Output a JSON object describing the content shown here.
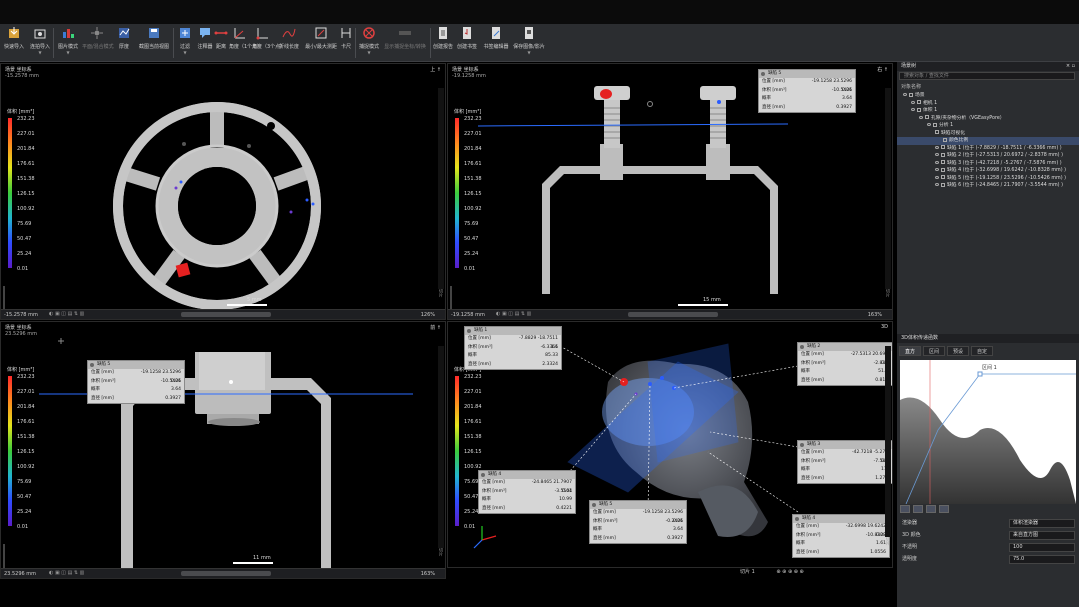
{
  "ribbon": [
    {
      "id": "import",
      "label": "快速导入",
      "icon": "import-icon"
    },
    {
      "id": "capture",
      "label": "连拍导入",
      "icon": "capture-icon",
      "has_menu": true
    },
    {
      "id": "render-mode",
      "label": "图片模式",
      "icon": "render-mode-icon",
      "has_menu": true
    },
    {
      "id": "flat-mode",
      "label": "平面/混合模式",
      "icon": "light-icon",
      "dim": true
    },
    {
      "id": "profile",
      "label": "厚度",
      "icon": "profile-icon"
    },
    {
      "id": "save-view",
      "label": "截图当前视图",
      "icon": "save-view-icon"
    },
    {
      "id": "filter",
      "label": "过滤",
      "icon": "filter-icon",
      "has_menu": true
    },
    {
      "id": "annotation",
      "label": "注释器",
      "icon": "comment-icon"
    },
    {
      "id": "distance",
      "label": "距离",
      "icon": "ruler-icon"
    },
    {
      "id": "angle1",
      "label": "角度（1个点）",
      "icon": "angle-icon"
    },
    {
      "id": "angle3",
      "label": "角度（3个点）",
      "icon": "angle3-icon"
    },
    {
      "id": "curve",
      "label": "折线长度",
      "icon": "curve-icon"
    },
    {
      "id": "minmax",
      "label": "最小/最大测距",
      "icon": "minmax-icon"
    },
    {
      "id": "caliper",
      "label": "卡尺",
      "icon": "caliper-icon"
    },
    {
      "id": "capture-mode",
      "label": "捕捉模式",
      "icon": "capture-mode-icon",
      "has_menu": true
    },
    {
      "id": "nudge",
      "label": "显示捕捉坐标/转换",
      "icon": "nudge-icon",
      "dim": true
    },
    {
      "id": "report",
      "label": "创建报告",
      "icon": "report-icon"
    },
    {
      "id": "bookmark",
      "label": "创建书签",
      "icon": "bookmark-icon"
    },
    {
      "id": "note-editor",
      "label": "书签编辑器",
      "icon": "note-editor-icon"
    },
    {
      "id": "save-image",
      "label": "保存图像/影片",
      "icon": "save-image-icon",
      "has_menu": true
    }
  ],
  "viewports": {
    "top_left": {
      "name": "场景 坐标系",
      "coord": "-15.2578 mm",
      "corner": "上 ↑",
      "side_label": "切片",
      "scroll_value": "-15.2578 mm",
      "zoom": "126%",
      "scale_label": "5 mm",
      "legend_title": "体积 [mm³]"
    },
    "top_right": {
      "name": "场景 坐标系",
      "coord": "-19.1258 mm",
      "corner": "右 ↑",
      "side_label": "切片",
      "scroll_value": "-19.1258 mm",
      "zoom": "163%",
      "scale_label": "15 mm",
      "legend_title": "体积 [mm³]"
    },
    "bottom_left": {
      "name": "场景 坐标系",
      "coord": "23.5296 mm",
      "corner": "前 ↑",
      "side_label": "切片",
      "scroll_value": "23.5296 mm",
      "zoom": "163%",
      "scale_label": "11 mm",
      "legend_title": "体积 [mm³]"
    },
    "bottom_right": {
      "name": "",
      "coord": "",
      "corner": "3D",
      "side_label": "切片",
      "legend_title": "体积 [mm³]"
    }
  },
  "legend_ticks": [
    "232.23",
    "227.01",
    "201.84",
    "176.61",
    "151.38",
    "126.15",
    "100.92",
    "75.69",
    "50.47",
    "25.24",
    "0.01"
  ],
  "annotations": [
    {
      "id": "vr-tr",
      "title": "缺陷 5",
      "rows": [
        [
          "位置 [mm]",
          "-19.1258  23.5296  -10.5426"
        ],
        [
          "体积 [mm³]",
          "0.01"
        ],
        [
          "概率",
          "3.64"
        ],
        [
          "直径 [mm]",
          "0.3927"
        ]
      ]
    },
    {
      "id": "vr-bl",
      "title": "缺陷 5",
      "rows": [
        [
          "位置 [mm]",
          "-19.1258  23.5296  -10.5426"
        ],
        [
          "体积 [mm³]",
          "0.01"
        ],
        [
          "概率",
          "3.64"
        ],
        [
          "直径 [mm]",
          "0.3927"
        ]
      ]
    },
    {
      "id": "3d-1",
      "title": "缺陷 1",
      "rows": [
        [
          "位置 [mm]",
          "-7.8829  -18.7511  -6.3366"
        ],
        [
          "体积 [mm³]",
          "1.1"
        ],
        [
          "概率",
          "85.33"
        ],
        [
          "直径 [mm]",
          "2.3324"
        ]
      ]
    },
    {
      "id": "3d-2",
      "title": "缺陷 2",
      "rows": [
        [
          "位置 [mm]",
          "-27.5313  20.6972  -2.8378"
        ],
        [
          "体积 [mm³]",
          "0.11"
        ],
        [
          "概率",
          "51.16"
        ],
        [
          "直径 [mm]",
          "0.8185"
        ]
      ]
    },
    {
      "id": "3d-3",
      "title": "缺陷 3",
      "rows": [
        [
          "位置 [mm]",
          "-42.7218  -5.2767  -7.5876"
        ],
        [
          "体积 [mm³]",
          "0.15"
        ],
        [
          "概率",
          "11.4"
        ],
        [
          "直径 [mm]",
          "1.2763"
        ]
      ]
    },
    {
      "id": "3d-4a",
      "title": "缺陷 4",
      "rows": [
        [
          "位置 [mm]",
          "-24.8465  21.7907  -3.5544"
        ],
        [
          "体积 [mm³]",
          "0.01"
        ],
        [
          "概率",
          "10.99"
        ],
        [
          "直径 [mm]",
          "0.4221"
        ]
      ]
    },
    {
      "id": "3d-5",
      "title": "缺陷 5",
      "rows": [
        [
          "位置 [mm]",
          "-19.1258  23.5296  -0.2426"
        ],
        [
          "体积 [mm³]",
          "0.01"
        ],
        [
          "概率",
          "3.64"
        ],
        [
          "直径 [mm]",
          "0.3927"
        ]
      ]
    },
    {
      "id": "3d-4b",
      "title": "缺陷 4",
      "rows": [
        [
          "位置 [mm]",
          "-32.6998  19.6242  -10.8328"
        ],
        [
          "体积 [mm³]",
          "0.08"
        ],
        [
          "概率",
          "1.61"
        ],
        [
          "直径 [mm]",
          "1.0556"
        ]
      ]
    }
  ],
  "scene_panel": {
    "title": "场景树",
    "search_placeholder": "搜索对象 / 查找文件",
    "tree_header": "对象名称",
    "items": [
      {
        "label": "场景",
        "indent": 0
      },
      {
        "label": "相机 1",
        "indent": 1
      },
      {
        "label": "体积 1",
        "indent": 1
      },
      {
        "label": "孔隙/夹杂物分析（VGEasyPore）",
        "indent": 2
      },
      {
        "label": "分析 1",
        "indent": 3
      },
      {
        "label": "缺陷可视化",
        "indent": 4
      },
      {
        "label": "颜色比例",
        "indent": 5,
        "selected": true
      },
      {
        "label": "缺陷 1 (位于 (-7.8829 / -18.7511 / -6.3366 mm) )",
        "indent": 4
      },
      {
        "label": "缺陷 2 (位于 (-27.5313 / 20.6972 / -2.8378 mm) )",
        "indent": 4
      },
      {
        "label": "缺陷 3 (位于 (-42.7218 / -5.2767 / -7.5876 mm) )",
        "indent": 4
      },
      {
        "label": "缺陷 4 (位于 (-32.6998 / 19.6242 / -10.8328 mm) )",
        "indent": 4
      },
      {
        "label": "缺陷 5 (位于 (-19.1258 / 23.5296 / -10.5426 mm) )",
        "indent": 4
      },
      {
        "label": "缺陷 6 (位于 (-24.8465 / 21.7907 / -3.5544 mm) )",
        "indent": 4
      }
    ]
  },
  "histogram_panel": {
    "title": "3D体积传递函数",
    "tabs": [
      "直方",
      "区间",
      "预设",
      "自定"
    ],
    "marker_label": "区间 1",
    "props": [
      [
        "渲染器",
        "体积渲染器"
      ],
      [
        "3D 颜色",
        "来自直方图"
      ],
      [
        "不透明",
        "100"
      ],
      [
        "透明度",
        "75.0"
      ]
    ]
  },
  "status": {
    "slice_label": "切片",
    "slice_value": "1"
  },
  "colors": {
    "accent": "#2b6cff",
    "plane": "#1f5fd6",
    "defect_red": "#e52020"
  }
}
